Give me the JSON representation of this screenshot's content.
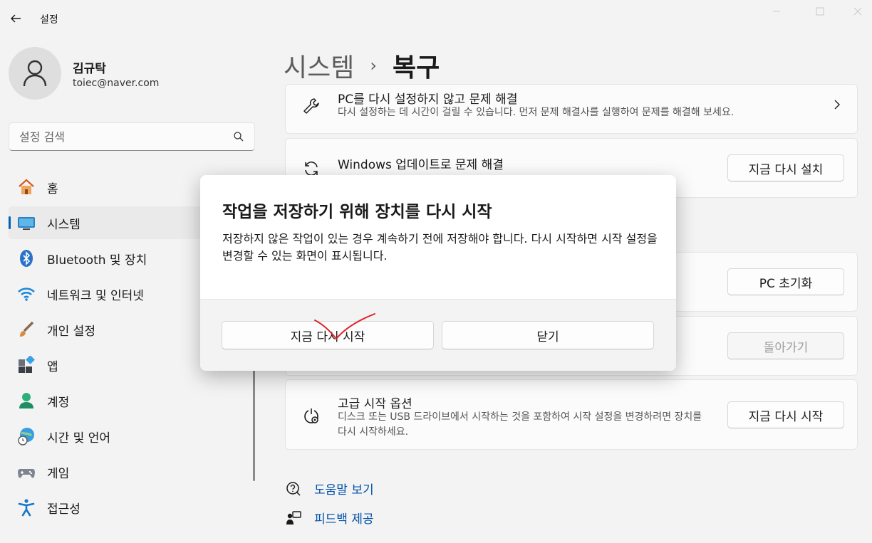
{
  "window": {
    "title": "설정"
  },
  "profile": {
    "name": "김규탁",
    "email": "toiec@naver.com"
  },
  "search": {
    "placeholder": "설정 검색"
  },
  "sidebar": {
    "items": [
      {
        "label": "홈",
        "icon": "home-icon"
      },
      {
        "label": "시스템",
        "icon": "system-icon",
        "active": true
      },
      {
        "label": "Bluetooth 및 장치",
        "icon": "bluetooth-icon"
      },
      {
        "label": "네트워크 및 인터넷",
        "icon": "wifi-icon"
      },
      {
        "label": "개인 설정",
        "icon": "brush-icon"
      },
      {
        "label": "앱",
        "icon": "apps-icon"
      },
      {
        "label": "계정",
        "icon": "account-icon"
      },
      {
        "label": "시간 및 언어",
        "icon": "globe-clock-icon"
      },
      {
        "label": "게임",
        "icon": "gamepad-icon"
      },
      {
        "label": "접근성",
        "icon": "accessibility-icon"
      }
    ]
  },
  "breadcrumb": {
    "parent": "시스템",
    "separator": "›",
    "current": "복구"
  },
  "cards": {
    "troubleshoot": {
      "title": "PC를 다시 설정하지 않고 문제 해결",
      "desc": "다시 설정하는 데 시간이 걸릴 수 있습니다. 먼저 문제 해결사를 실행하여 문제를 해결해 보세요."
    },
    "windows_update": {
      "title": "Windows 업데이트로 문제 해결",
      "button": "지금 다시 설치"
    },
    "reset_pc": {
      "button": "PC 초기화"
    },
    "go_back": {
      "button": "돌아가기"
    },
    "advanced_startup": {
      "title": "고급 시작 옵션",
      "desc": "디스크 또는 USB 드라이브에서 시작하는 것을 포함하여 시작 설정을 변경하려면 장치를 다시 시작하세요.",
      "button": "지금 다시 시작"
    }
  },
  "links": {
    "help": "도움말 보기",
    "feedback": "피드백 제공"
  },
  "dialog": {
    "title": "작업을 저장하기 위해 장치를 다시 시작",
    "body": "저장하지 않은 작업이 있는 경우 계속하기 전에 저장해야 합니다. 다시 시작하면 시작 설정을 변경할 수 있는 화면이 표시됩니다.",
    "primary_button": "지금 다시 시작",
    "close_button": "닫기"
  },
  "colors": {
    "accent": "#005fb8",
    "link": "#0050a8",
    "annotation": "#e0202a"
  }
}
